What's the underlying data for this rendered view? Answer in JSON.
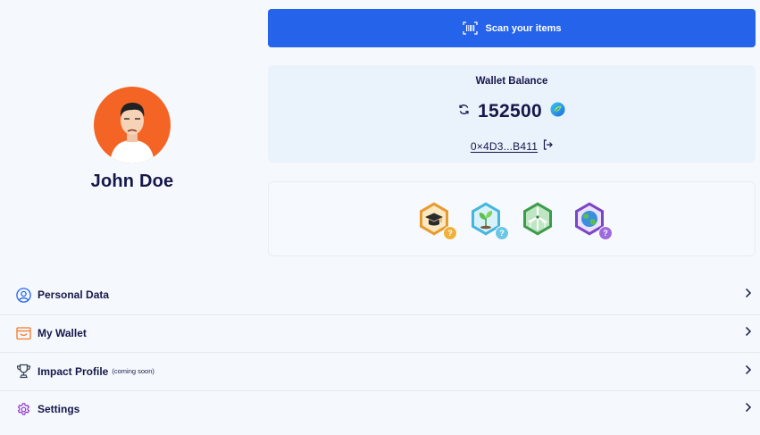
{
  "scan": {
    "label": "Scan your items"
  },
  "user": {
    "name": "John Doe"
  },
  "wallet": {
    "title": "Wallet Balance",
    "balance": "152500",
    "address": "0×4D3...B411"
  },
  "badges": [
    {
      "icon": "graduation-cap-icon",
      "color": "#e79a2e",
      "status": "?"
    },
    {
      "icon": "plant-icon",
      "color": "#44b6dc",
      "status": "?"
    },
    {
      "icon": "wind-turbine-icon",
      "color": "#3d9c4a",
      "status": ""
    },
    {
      "icon": "globe-icon",
      "color": "#7b45c6",
      "status": "?"
    }
  ],
  "menu": {
    "items": [
      {
        "label": "Personal Data",
        "sub": "",
        "icon": "user-circle-icon",
        "color": "#2563eb"
      },
      {
        "label": "My Wallet",
        "sub": "",
        "icon": "wallet-icon",
        "color": "#f47b2a"
      },
      {
        "label": "Impact Profile",
        "sub": "(coming soon)",
        "icon": "trophy-icon",
        "color": "#374151"
      },
      {
        "label": "Settings",
        "sub": "",
        "icon": "gear-icon",
        "color": "#8b2fc9"
      }
    ]
  },
  "colors": {
    "primary": "#2563eb",
    "text": "#16174a",
    "card": "#eaf2fb",
    "avatar_bg": "#f46424"
  }
}
